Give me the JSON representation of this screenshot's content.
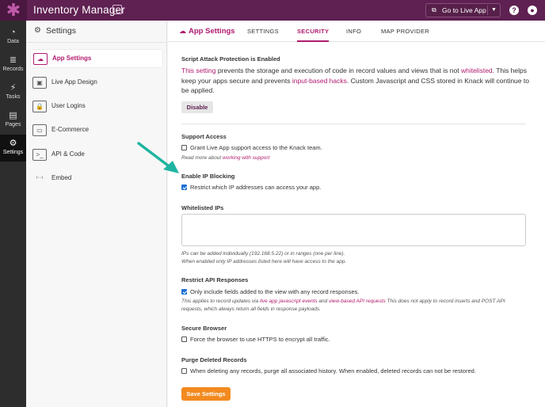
{
  "topbar": {
    "logo_glyph": "✱",
    "app_title": "Inventory Manager",
    "goto_label": "Go to Live App",
    "help_glyph": "?",
    "account_glyph": "●"
  },
  "sidenav": {
    "items": [
      {
        "icon": "◔",
        "label": "Data"
      },
      {
        "icon": "≣",
        "label": "Records"
      },
      {
        "icon": "⚡",
        "label": "Tasks"
      },
      {
        "icon": "▤",
        "label": "Pages"
      },
      {
        "icon": "⚙",
        "label": "Settings"
      }
    ]
  },
  "settings_panel": {
    "title": "Settings",
    "items": [
      {
        "icon": "☁",
        "label": "App Settings"
      },
      {
        "icon": "▣",
        "label": "Live App Design"
      },
      {
        "icon": "🔒",
        "label": "User Logins"
      },
      {
        "icon": "▭",
        "label": "E-Commerce"
      },
      {
        "icon": ">_",
        "label": "API & Code"
      },
      {
        "icon": "‹··›",
        "label": "Embed"
      }
    ]
  },
  "tabs": {
    "section": "App Settings",
    "items": [
      "SETTINGS",
      "SECURITY",
      "INFO",
      "MAP PROVIDER"
    ]
  },
  "security": {
    "script_protection": {
      "heading": "Script Attack Protection is Enabled",
      "part1": "This setting",
      "part2": " prevents the storage and execution of code in record values and views that is not ",
      "part3": "whitelisted",
      "part4": ". This helps keep your apps secure and prevents ",
      "part5": "input-based hacks",
      "part6": ". Custom Javascript and CSS stored in Knack will continue to be applied.",
      "disable_label": "Disable"
    },
    "support_access": {
      "heading": "Support Access",
      "checkbox_label": "Grant Live App support access to the Knack team.",
      "checked": false,
      "hint_prefix": "Read more about ",
      "hint_link": "working with support"
    },
    "ip_blocking": {
      "heading": "Enable IP Blocking",
      "checkbox_label": "Restrict which IP addresses can access your app.",
      "checked": true
    },
    "whitelisted_ips": {
      "heading": "Whitelisted IPs",
      "value": "",
      "hint_line1": "IPs can be added individually (192.168.5.22) or in ranges (one per line).",
      "hint_line2": "When enabled only IP addresses listed here will have access to the app."
    },
    "restrict_api": {
      "heading": "Restrict API Responses",
      "checkbox_label": "Only include fields added to the view with any record responses.",
      "checked": true,
      "hint_a": "This applies to record updates via ",
      "hint_link1": "live app javascript events",
      "hint_b": " and ",
      "hint_link2": "view-based API requests",
      "hint_c": " This does not apply to record inserts and POST API requests, which always return all fields in response payloads."
    },
    "secure_browser": {
      "heading": "Secure Browser",
      "checkbox_label": "Force the browser to use HTTPS to encrypt all traffic.",
      "checked": false
    },
    "purge_deleted": {
      "heading": "Purge Deleted Records",
      "checkbox_label": "When deleting any records, purge all associated history. When enabled, deleted records can not be restored.",
      "checked": false
    },
    "save_label": "Save Settings"
  },
  "colors": {
    "brand": "#5f2052",
    "accent": "#b01b6f",
    "save_button": "#f28a1f",
    "arrow": "#1fb5a0",
    "checkbox": "#1f6fd1"
  }
}
